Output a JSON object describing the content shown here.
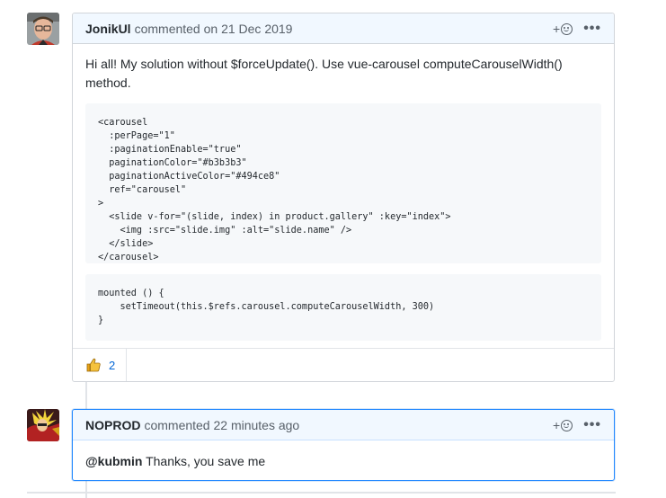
{
  "comments": [
    {
      "author": "JonikUl",
      "meta": "commented on 21 Dec 2019",
      "text": "Hi all! My solution without $forceUpdate(). Use vue-carousel computeCarouselWidth() method.",
      "code_blocks": [
        "<carousel\n  :perPage=\"1\"\n  :paginationEnable=\"true\"\n  paginationColor=\"#b3b3b3\"\n  paginationActiveColor=\"#494ce8\"\n  ref=\"carousel\"\n>\n  <slide v-for=\"(slide, index) in product.gallery\" :key=\"index\">\n    <img :src=\"slide.img\" :alt=\"slide.name\" />\n  </slide>\n</carousel>",
        "mounted () {\n    setTimeout(this.$refs.carousel.computeCarouselWidth, 300)\n}"
      ],
      "reactions": [
        {
          "icon": "thumbs-up-icon",
          "count": "2"
        }
      ]
    },
    {
      "author": "NOPROD",
      "meta": "commented 22 minutes ago",
      "mention": "@kubmin",
      "text": " Thanks, you save me"
    }
  ],
  "actions": {
    "add_reaction": "+",
    "more": "•••"
  },
  "icons": {
    "add_reaction": "smiley-icon",
    "more": "kebab-icon"
  },
  "colors": {
    "link": "#0366d6",
    "current_border": "#2188ff",
    "header_bg": "#f1f8ff"
  }
}
